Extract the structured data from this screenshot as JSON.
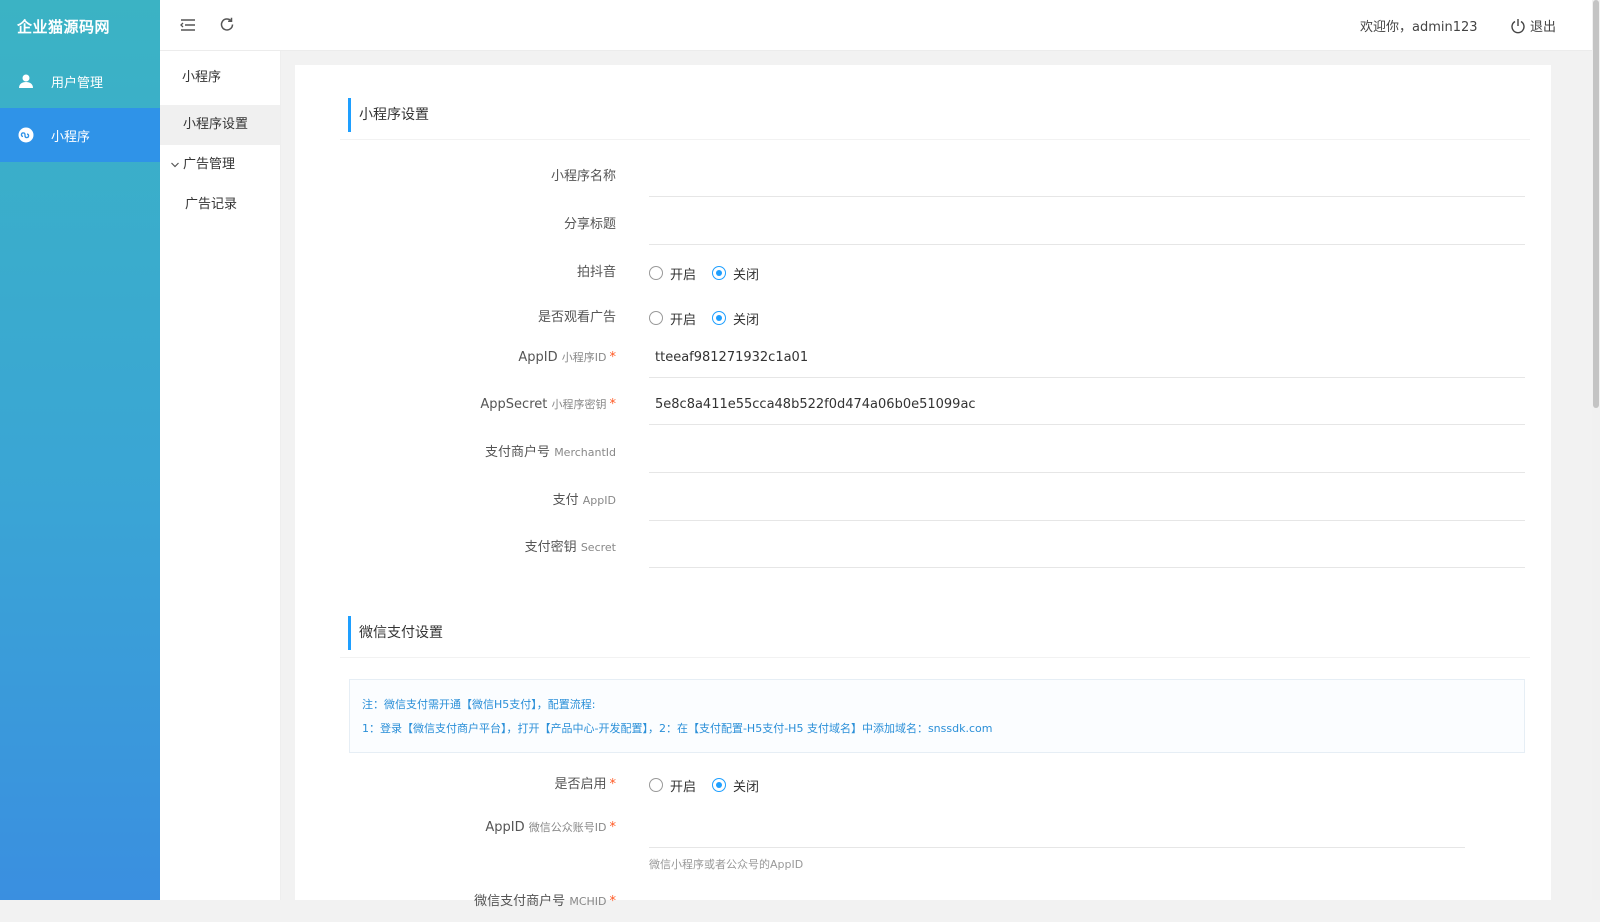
{
  "brand": "企业猫源码网",
  "sidebar": {
    "items": [
      {
        "label": "用户管理",
        "icon": "user-icon"
      },
      {
        "label": "小程序",
        "icon": "miniprogram-icon"
      }
    ]
  },
  "topbar": {
    "welcome": "欢迎你，admin123",
    "logout": "退出"
  },
  "submenu": {
    "title": "小程序",
    "items": [
      {
        "label": "小程序设置"
      },
      {
        "label": "广告管理"
      },
      {
        "label": "广告记录"
      }
    ]
  },
  "section1": {
    "title": "小程序设置",
    "name_label": "小程序名称",
    "name_value": "",
    "share_label": "分享标题",
    "share_value": "",
    "douyin_label": "拍抖音",
    "ad_label": "是否观看广告",
    "on": "开启",
    "off": "关闭",
    "appid_label": "AppID",
    "appid_sub": "小程序ID",
    "appid_value": "tteeaf981271932c1a01",
    "secret_label": "AppSecret",
    "secret_sub": "小程序密钥",
    "secret_value": "5e8c8a411e55cca48b522f0d474a06b0e51099ac",
    "merchant_label": "支付商户号",
    "merchant_sub": "MerchantId",
    "merchant_value": "",
    "payappid_label": "支付",
    "payappid_sub": "AppID",
    "payappid_value": "",
    "paysecret_label": "支付密钥",
    "paysecret_sub": "Secret",
    "paysecret_value": ""
  },
  "section2": {
    "title": "微信支付设置",
    "note_line1": "注：微信支付需开通【微信H5支付】，配置流程:",
    "note_line2": "1：登录【微信支付商户平台】，打开【产品中心-开发配置】，2：在【支付配置-H5支付-H5 支付域名】中添加域名：snssdk.com",
    "enable_label": "是否启用",
    "on": "开启",
    "off": "关闭",
    "appid_label": "AppID",
    "appid_sub": "微信公众账号ID",
    "appid_value": "",
    "appid_hint": "微信小程序或者公众号的AppID",
    "mchid_label": "微信支付商户号",
    "mchid_sub": "MCHID"
  },
  "required_mark": "*"
}
